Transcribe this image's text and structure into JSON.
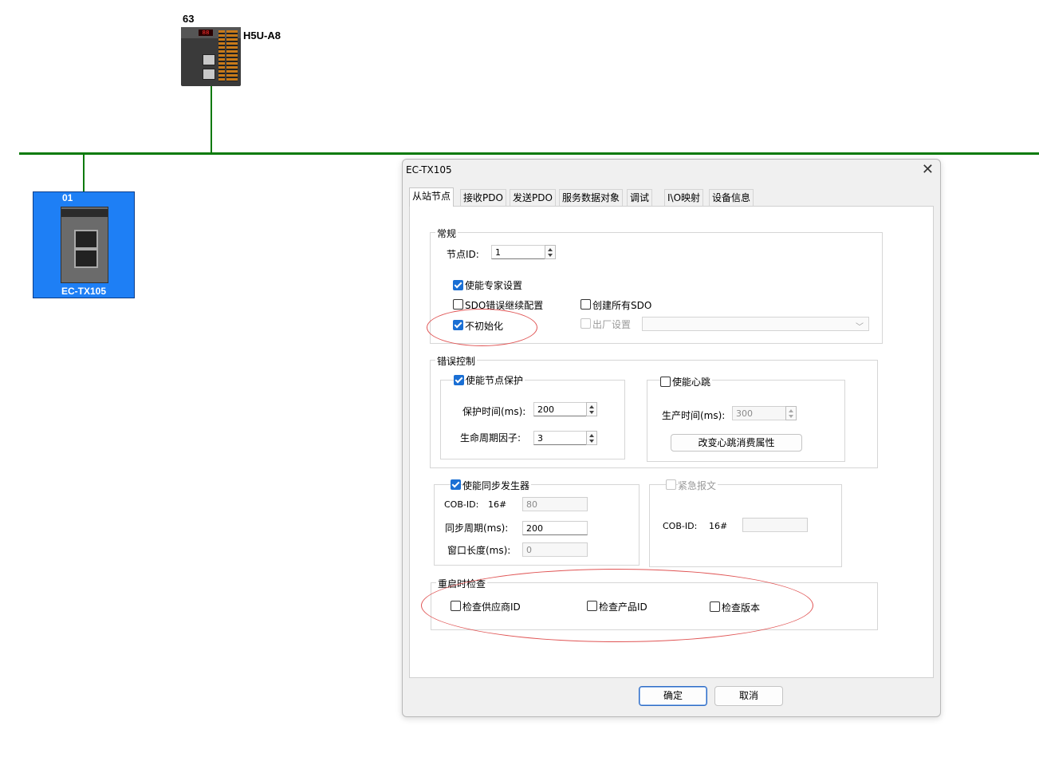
{
  "canvas": {
    "master": {
      "address": "63",
      "model": "H5U-A8",
      "display": "88"
    },
    "slave": {
      "address": "01",
      "name": "EC-TX105"
    }
  },
  "dialog": {
    "title": "EC-TX105",
    "close_icon": "close-icon",
    "tabs": [
      "从站节点",
      "接收PDO",
      "发送PDO",
      "服务数据对象",
      "调试",
      "I\\O映射",
      "设备信息"
    ],
    "active_tab": "从站节点",
    "general": {
      "label": "常规",
      "node_id_label": "节点ID:",
      "node_id_value": "1",
      "enable_expert_label": "使能专家设置",
      "enable_expert_checked": true,
      "sdo_error_continue_label": "SDO错误继续配置",
      "sdo_error_continue_checked": false,
      "create_all_sdo_label": "创建所有SDO",
      "create_all_sdo_checked": false,
      "no_init_label": "不初始化",
      "no_init_checked": true,
      "factory_settings_label": "出厂设置",
      "factory_settings_checked": false,
      "factory_settings_select": ""
    },
    "error_control": {
      "label": "错误控制",
      "node_guard_label": "使能节点保护",
      "node_guard_checked": true,
      "guard_time_label": "保护时间(ms):",
      "guard_time_value": "200",
      "life_factor_label": "生命周期因子:",
      "life_factor_value": "3",
      "heartbeat_label": "使能心跳",
      "heartbeat_checked": false,
      "producer_time_label": "生产时间(ms):",
      "producer_time_value": "300",
      "change_heartbeat_button": "改变心跳消费属性"
    },
    "sync": {
      "label": "使能同步发生器",
      "checked": true,
      "cob_id_label": "COB-ID:",
      "hex_prefix": "16#",
      "cob_id_value": "80",
      "period_label": "同步周期(ms):",
      "period_value": "200",
      "window_label": "窗口长度(ms):",
      "window_value": "0"
    },
    "emergency": {
      "label": "紧急报文",
      "checked": false,
      "cob_id_label": "COB-ID:",
      "hex_prefix": "16#",
      "cob_id_value": ""
    },
    "restart_check": {
      "label": "重启时检查",
      "vendor_label": "检查供应商ID",
      "vendor_checked": false,
      "product_label": "检查产品ID",
      "product_checked": false,
      "version_label": "检查版本",
      "version_checked": false
    },
    "ok_button": "确定",
    "cancel_button": "取消"
  },
  "colors": {
    "bus": "#0a7a0a",
    "slave_bg": "#1e7ff5",
    "checkbox_checked": "#1a6fd4",
    "annotation": "#e05555"
  }
}
